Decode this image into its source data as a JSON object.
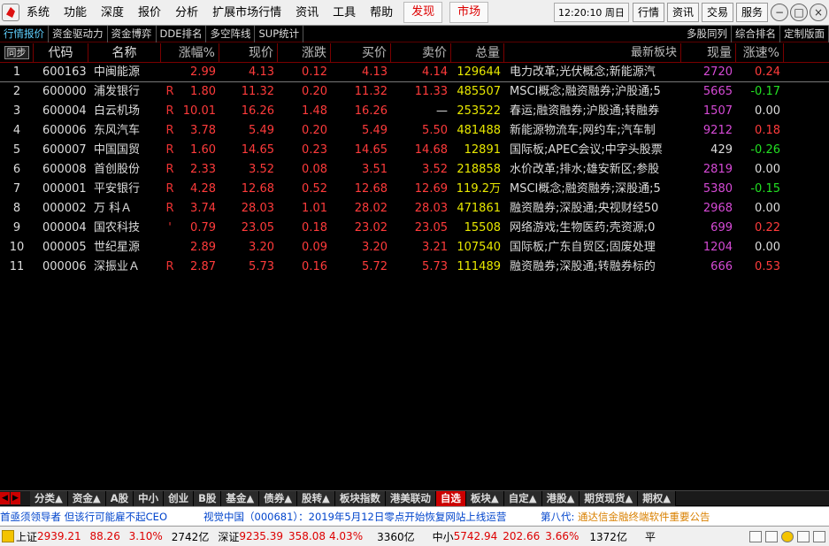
{
  "menu": {
    "items": [
      "系统",
      "功能",
      "深度",
      "报价",
      "分析",
      "扩展市场行情",
      "资讯",
      "工具",
      "帮助"
    ],
    "highlight": [
      "发现",
      "市场"
    ],
    "clock": "12:20:10 周日",
    "right_buttons": [
      "行情",
      "资讯",
      "交易",
      "服务"
    ]
  },
  "tabs": {
    "left": [
      "行情报价",
      "资金驱动力",
      "资金博弈",
      "DDE排名",
      "多空阵线",
      "SUP统计"
    ],
    "right": [
      "多股同列",
      "综合排名",
      "定制版面"
    ]
  },
  "table": {
    "sync_label": "同步",
    "headers": {
      "code": "代码",
      "name": "名称",
      "pct": "涨幅%",
      "now": "现价",
      "chg": "涨跌",
      "buy": "买价",
      "sell": "卖价",
      "vol": "总量",
      "block": "最新板块",
      "cur": "现量",
      "spd": "涨速%"
    },
    "rows": [
      {
        "idx": "1",
        "code": "600163",
        "name": "中闽能源",
        "r": "",
        "pct": "2.99",
        "now": "4.13",
        "chg": "0.12",
        "buy": "4.13",
        "sell": "4.14",
        "vol": "129644",
        "block": "电力改革;光伏概念;新能源汽",
        "cur": "2720",
        "curc": "magenta",
        "spd": "0.24",
        "spdc": "red",
        "pc": "red",
        "sellc": "red"
      },
      {
        "idx": "2",
        "code": "600000",
        "name": "浦发银行",
        "r": "R",
        "pct": "1.80",
        "now": "11.32",
        "chg": "0.20",
        "buy": "11.32",
        "sell": "11.33",
        "vol": "485507",
        "block": "MSCI概念;融资融券;沪股通;5",
        "cur": "5665",
        "curc": "magenta",
        "spd": "-0.17",
        "spdc": "green",
        "pc": "red",
        "sellc": "red"
      },
      {
        "idx": "3",
        "code": "600004",
        "name": "白云机场",
        "r": "R",
        "pct": "10.01",
        "now": "16.26",
        "chg": "1.48",
        "buy": "16.26",
        "sell": "—",
        "vol": "253522",
        "block": "春运;融资融券;沪股通;转融券",
        "cur": "1507",
        "curc": "magenta",
        "spd": "0.00",
        "spdc": "white",
        "pc": "red",
        "sellc": "white"
      },
      {
        "idx": "4",
        "code": "600006",
        "name": "东风汽车",
        "r": "R",
        "pct": "3.78",
        "now": "5.49",
        "chg": "0.20",
        "buy": "5.49",
        "sell": "5.50",
        "vol": "481488",
        "block": "新能源物流车;网约车;汽车制",
        "cur": "9212",
        "curc": "magenta",
        "spd": "0.18",
        "spdc": "red",
        "pc": "red",
        "sellc": "red"
      },
      {
        "idx": "5",
        "code": "600007",
        "name": "中国国贸",
        "r": "R",
        "pct": "1.60",
        "now": "14.65",
        "chg": "0.23",
        "buy": "14.65",
        "sell": "14.68",
        "vol": "12891",
        "block": "国际板;APEC会议;中字头股票",
        "cur": "429",
        "curc": "white",
        "spd": "-0.26",
        "spdc": "green",
        "pc": "red",
        "sellc": "red"
      },
      {
        "idx": "6",
        "code": "600008",
        "name": "首创股份",
        "r": "R",
        "pct": "2.33",
        "now": "3.52",
        "chg": "0.08",
        "buy": "3.51",
        "sell": "3.52",
        "vol": "218858",
        "block": "水价改革;排水;雄安新区;参股",
        "cur": "2819",
        "curc": "magenta",
        "spd": "0.00",
        "spdc": "white",
        "pc": "red",
        "sellc": "red"
      },
      {
        "idx": "7",
        "code": "000001",
        "name": "平安银行",
        "r": "R",
        "pct": "4.28",
        "now": "12.68",
        "chg": "0.52",
        "buy": "12.68",
        "sell": "12.69",
        "vol": "119.2万",
        "block": "MSCI概念;融资融券;深股通;5",
        "cur": "5380",
        "curc": "magenta",
        "spd": "-0.15",
        "spdc": "green",
        "pc": "red",
        "sellc": "red"
      },
      {
        "idx": "8",
        "code": "000002",
        "name": "万 科Ａ",
        "r": "R",
        "pct": "3.74",
        "now": "28.03",
        "chg": "1.01",
        "buy": "28.02",
        "sell": "28.03",
        "vol": "471861",
        "block": "融资融券;深股通;央视财经50",
        "cur": "2968",
        "curc": "magenta",
        "spd": "0.00",
        "spdc": "white",
        "pc": "red",
        "sellc": "red"
      },
      {
        "idx": "9",
        "code": "000004",
        "name": "国农科技",
        "r": "'",
        "pct": "0.79",
        "now": "23.05",
        "chg": "0.18",
        "buy": "23.02",
        "sell": "23.05",
        "vol": "15508",
        "block": "网络游戏;生物医药;壳资源;0",
        "cur": "699",
        "curc": "magenta",
        "spd": "0.22",
        "spdc": "red",
        "pc": "red",
        "sellc": "red"
      },
      {
        "idx": "10",
        "code": "000005",
        "name": "世纪星源",
        "r": "",
        "pct": "2.89",
        "now": "3.20",
        "chg": "0.09",
        "buy": "3.20",
        "sell": "3.21",
        "vol": "107540",
        "block": "国际板;广东自贸区;固废处理",
        "cur": "1204",
        "curc": "magenta",
        "spd": "0.00",
        "spdc": "white",
        "pc": "red",
        "sellc": "red"
      },
      {
        "idx": "11",
        "code": "000006",
        "name": "深振业Ａ",
        "r": "R",
        "pct": "2.87",
        "now": "5.73",
        "chg": "0.16",
        "buy": "5.72",
        "sell": "5.73",
        "vol": "111489",
        "block": "融资融券;深股通;转融券标的",
        "cur": "666",
        "curc": "magenta",
        "spd": "0.53",
        "spdc": "red",
        "pc": "red",
        "sellc": "red"
      }
    ]
  },
  "bottom_tabs": [
    "分类▲",
    "资金▲",
    "A股",
    "中小",
    "创业",
    "B股",
    "基金▲",
    "债券▲",
    "股转▲",
    "板块指数",
    "港美联动",
    "自选",
    "板块▲",
    "自定▲",
    "港股▲",
    "期货现货▲",
    "期权▲"
  ],
  "bottom_active": "自选",
  "ticker": {
    "t1": "首亟须领导者 但该行可能雇不起CEO",
    "t2": "视觉中国（000681）：2019年5月12日零点开始恢复网站上线运营",
    "t3": "第八代:",
    "t4": "通达信金融终端软件重要公告"
  },
  "status": {
    "sh_label": "上证",
    "sh_val": "2939.21",
    "sh_chg": "88.26",
    "sh_pct": "3.10%",
    "sh_amt": "2742亿",
    "sz_label": "深证",
    "sz_val": "9235.39",
    "sz_chg": "358.08",
    "sz_pct": "4.03%",
    "sz_amt": "3360亿",
    "zx_label": "中小",
    "zx_val": "5742.94",
    "zx_chg": "202.66",
    "zx_pct": "3.66%",
    "zx_amt": "1372亿",
    "flat": "平"
  }
}
